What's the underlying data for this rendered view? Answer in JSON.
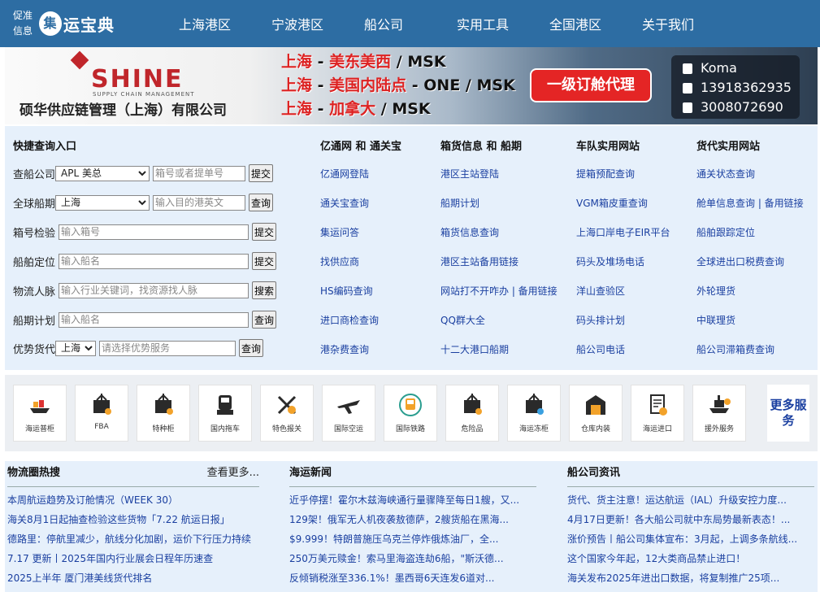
{
  "nav": {
    "logo_small": [
      "促准",
      "信息"
    ],
    "logo_big": "运宝典",
    "logo_mark": "集",
    "items": [
      "上海港区",
      "宁波港区",
      "船公司",
      "实用工具",
      "全国港区",
      "关于我们"
    ]
  },
  "banner": {
    "brand": "SHINE",
    "brand_sub": "SUPPLY CHAIN MANAGEMENT",
    "company": "硕华供应链管理（上海）有限公司",
    "routes": [
      {
        "from": "上海",
        "to": "美东美西",
        "carrier": "MSK"
      },
      {
        "from": "上海",
        "to": "美国内陆点",
        "carrier": "ONE / MSK"
      },
      {
        "from": "上海",
        "to": "加拿大",
        "carrier": "MSK"
      }
    ],
    "agent": "一级订舱代理",
    "contact": {
      "name": "Koma",
      "phone": "13918362935",
      "qq": "3008072690"
    }
  },
  "quick": {
    "title": "快捷查询入口",
    "rows": [
      {
        "label": "查船公司",
        "select": "APL 美总",
        "placeholder": "箱号或者提单号",
        "button": "提交"
      },
      {
        "label": "全球船期",
        "select": "上海",
        "placeholder": "输入目的港英文",
        "button": "查询"
      },
      {
        "label": "箱号检验",
        "placeholder": "输入箱号",
        "button": "提交"
      },
      {
        "label": "船舶定位",
        "placeholder": "输入船名",
        "button": "提交"
      },
      {
        "label": "物流人脉",
        "placeholder": "输入行业关键词，找资源找人脉",
        "button": "搜索"
      },
      {
        "label": "船期计划",
        "placeholder": "输入船名",
        "button": "查询"
      },
      {
        "label": "优势货代",
        "select": "上海",
        "placeholder": "请选择优势服务",
        "button": "查询"
      }
    ],
    "columns": [
      {
        "title": "亿通网 和 通关宝",
        "links": [
          "亿通网登陆",
          "通关宝查询",
          "集运问答",
          "找供应商",
          "HS编码查询",
          "进口商检查询",
          "港杂费查询"
        ]
      },
      {
        "title": "箱货信息 和 船期",
        "links": [
          "港区主站登陆",
          "船期计划",
          "箱货信息查询",
          "港区主站备用链接",
          "网站打不开咋办 | 备用链接",
          "QQ群大全",
          "十二大港口船期"
        ]
      },
      {
        "title": "车队实用网站",
        "links": [
          "提箱预配查询",
          "VGM箱皮重查询",
          "上海口岸电子EIR平台",
          "码头及堆场电话",
          "洋山查验区",
          "码头排计划",
          "船公司电话"
        ]
      },
      {
        "title": "货代实用网站",
        "links": [
          "通关状态查询",
          "舱单信息查询 | 备用链接",
          "船舶跟踪定位",
          "全球进出口税费查询",
          "外轮理货",
          "中联理货",
          "船公司滞箱费查询"
        ]
      }
    ]
  },
  "services": {
    "tiles": [
      {
        "label": "海运普柜",
        "icon": "ship-icon"
      },
      {
        "label": "FBA",
        "icon": "container-icon"
      },
      {
        "label": "特种柜",
        "icon": "special-container-icon"
      },
      {
        "label": "国内拖车",
        "icon": "truck-icon"
      },
      {
        "label": "特色报关",
        "icon": "customs-icon"
      },
      {
        "label": "国际空运",
        "icon": "plane-icon"
      },
      {
        "label": "国际铁路",
        "icon": "train-icon"
      },
      {
        "label": "危险品",
        "icon": "hazard-container-icon"
      },
      {
        "label": "海运冻柜",
        "icon": "reefer-container-icon"
      },
      {
        "label": "仓库内装",
        "icon": "warehouse-icon"
      },
      {
        "label": "海运进口",
        "icon": "import-document-icon"
      },
      {
        "label": "援外服务",
        "icon": "aid-ship-icon"
      }
    ],
    "more": "更多服务"
  },
  "news": {
    "col1": {
      "title": "物流圈热搜",
      "more": "查看更多...",
      "items": [
        "本周航运趋势及订舱情况（WEEK 30）",
        "海关8月1日起抽查检验这些货物「7.22 航运日报」",
        "德路里：停航里减少，航线分化加剧，运价下行压力持续",
        "7.17 更新丨2025年国内行业展会日程年历速查",
        "2025上半年 厦门港美线货代排名"
      ]
    },
    "col2": {
      "title": "海运新闻",
      "items": [
        "近乎停摆！霍尔木兹海峡通行量骤降至每日1艘，又...",
        "129架！俄军无人机夜袭敖德萨，2艘货船在黑海...",
        "$9.999！特朗普施压乌克兰停炸俄炼油厂，全...",
        "250万美元赎金！索马里海盗连劫6船，\"斯沃德...",
        "反倾销税涨至336.1%！墨西哥6天连发6道对..."
      ]
    },
    "col3": {
      "title": "船公司资讯",
      "items": [
        "货代、货主注意！运达航运（IAL）升级安控力度...",
        "4月17日更新！各大船公司就中东局势最新表态！...",
        "涨价预告丨船公司集体宣布：3月起，上调多条航线...",
        "这个国家今年起，12大类商品禁止进口！",
        "海关发布2025年进出口数据，将复制推广25项..."
      ]
    }
  },
  "colors": {
    "nav": "#2d6da3",
    "link": "#1a3fa0",
    "panel": "#e6f0fb",
    "accent_red": "#e42525"
  }
}
